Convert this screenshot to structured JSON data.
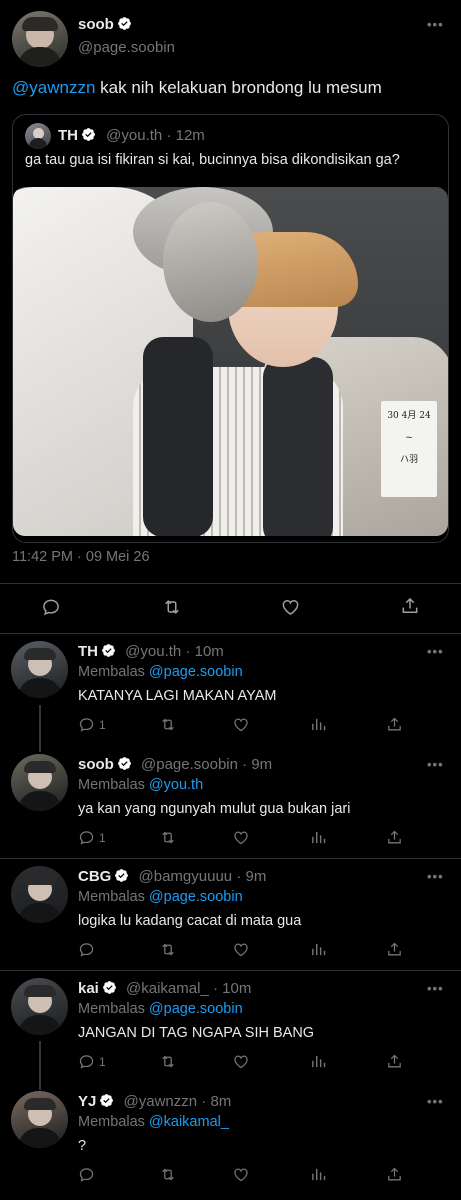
{
  "main_tweet": {
    "name": "soob",
    "handle": "@page.soobin",
    "mention": "@yawnzzn",
    "text": "kak nih kelakuan brondong lu mesum",
    "timestamp": "11:42 PM · 09 Mei 26",
    "quoted": {
      "name": "TH",
      "handle": "@you.th",
      "time": "· 12m",
      "text": "ga tau gua isi fikiran si kai, bucinnya bisa dikondisikan ga?",
      "photo_note_lines": [
        "30 4月 24",
        "~",
        "ハ羽"
      ]
    }
  },
  "replies": [
    {
      "name": "TH",
      "handle": "@you.th",
      "time": "· 10m",
      "replying_prefix": "Membalas",
      "replying_to": "@page.soobin",
      "text": "KATANYA LAGI MAKAN AYAM",
      "reply_count": "1",
      "avatar_color": "#5a5f66"
    },
    {
      "name": "soob",
      "handle": "@page.soobin",
      "time": "· 9m",
      "replying_prefix": "Membalas",
      "replying_to": "@you.th",
      "text": "ya kan yang ngunyah mulut gua bukan jari",
      "reply_count": "1",
      "avatar_color": "#6b6a5e"
    },
    {
      "name": "CBG",
      "handle": "@bamgyuuuu",
      "time": "· 9m",
      "replying_prefix": "Membalas",
      "replying_to": "@page.soobin",
      "text": "logika lu kadang cacat di mata gua",
      "reply_count": "",
      "avatar_color": "#2c2f33"
    },
    {
      "name": "kai",
      "handle": "@kaikamal_",
      "time": "· 10m",
      "replying_prefix": "Membalas",
      "replying_to": "@page.soobin",
      "text": "JANGAN DI TAG NGAPA SIH BANG",
      "reply_count": "1",
      "avatar_color": "#4a4d52"
    },
    {
      "name": "YJ",
      "handle": "@yawnzzn",
      "time": "· 8m",
      "replying_prefix": "Membalas",
      "replying_to": "@kaikamal_",
      "text": "?",
      "reply_count": "",
      "avatar_color": "#7a6a60"
    }
  ],
  "icons": {
    "verified": "verified-badge-icon",
    "reply": "reply-icon",
    "retweet": "retweet-icon",
    "like": "heart-icon",
    "views": "bar-chart-icon",
    "share": "share-icon",
    "more": "more-dots-icon"
  },
  "colors": {
    "background": "#000000",
    "accent": "#1d9bf0",
    "muted": "#71767b",
    "divider": "#2f3336"
  }
}
